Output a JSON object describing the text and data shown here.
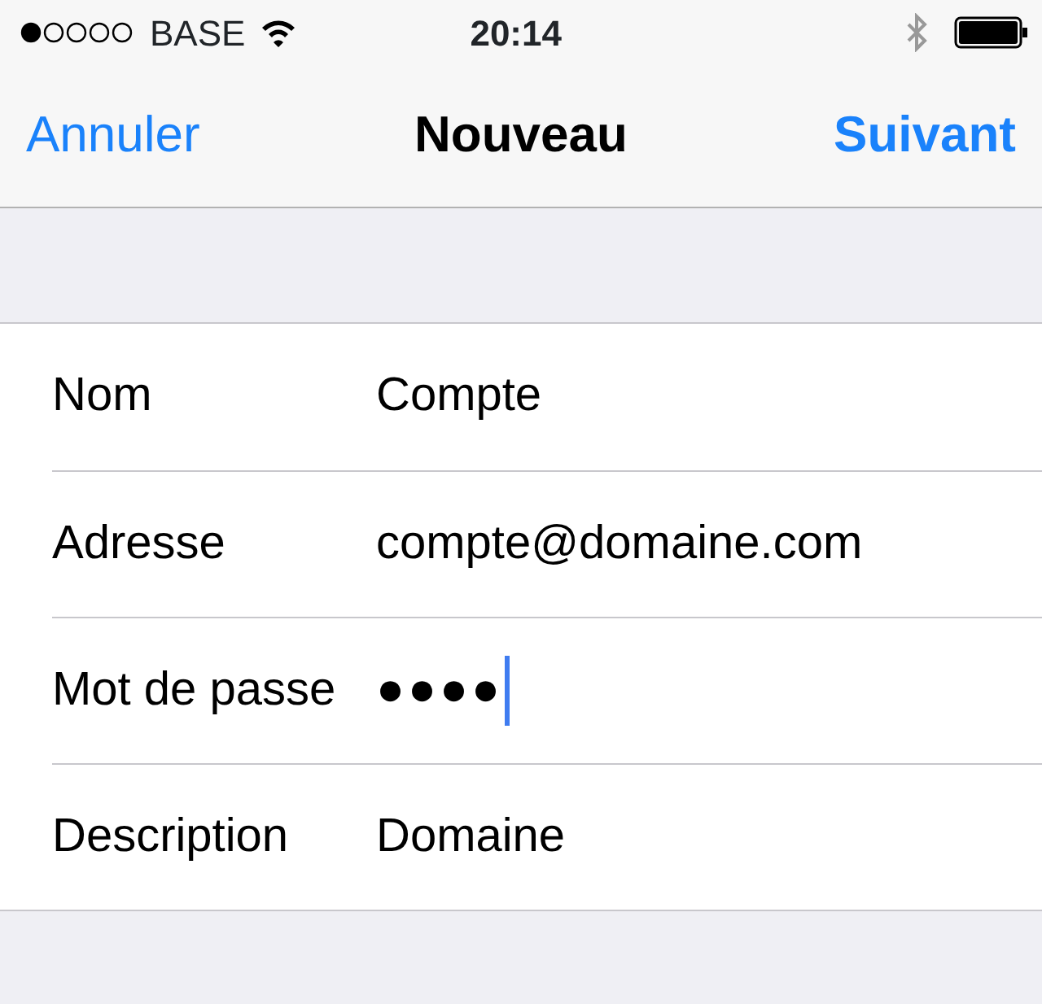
{
  "status_bar": {
    "carrier": "BASE",
    "time": "20:14"
  },
  "nav": {
    "left": "Annuler",
    "title": "Nouveau",
    "right": "Suivant"
  },
  "fields": [
    {
      "label": "Nom",
      "value": "Compte",
      "focused": false
    },
    {
      "label": "Adresse",
      "value": "compte@domaine.com",
      "focused": false
    },
    {
      "label": "Mot de passe",
      "value": "●●●●",
      "focused": true
    },
    {
      "label": "Description",
      "value": "Domaine",
      "focused": false
    }
  ]
}
